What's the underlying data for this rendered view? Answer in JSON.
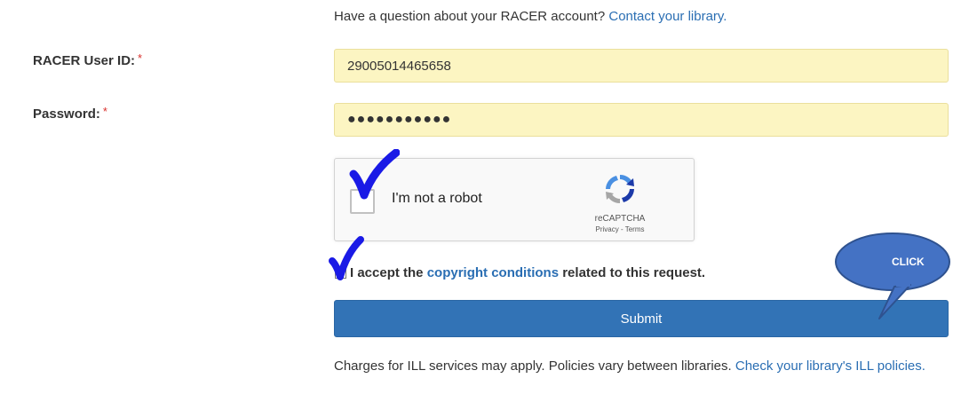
{
  "intro": {
    "text": "Have a question about your RACER account?",
    "link": "Contact your library."
  },
  "form": {
    "userid_label": "RACER User ID:",
    "password_label": "Password:",
    "required_marker": "*",
    "userid_value": "29005014465658",
    "password_value": "●●●●●●●●●●●"
  },
  "captcha": {
    "label": "I'm not a robot",
    "brand": "reCAPTCHA",
    "privacy": "Privacy",
    "separator": " - ",
    "terms": "Terms"
  },
  "copyright": {
    "prefix": "I accept the",
    "link": "copyright conditions",
    "suffix": "related to this request."
  },
  "submit_label": "Submit",
  "footer": {
    "text": "Charges for ILL services may apply. Policies vary between libraries.",
    "link": "Check your library's ILL policies."
  },
  "annotation": {
    "callout_text": "CLICK",
    "callout_color": "#4472c4",
    "check_color": "#1a1ae6"
  },
  "colors": {
    "link": "#2a6eb3",
    "input_bg": "#fcf5c2",
    "submit_bg": "#3273b6",
    "required": "#d9302c"
  },
  "icons": [
    "recaptcha-logo-icon",
    "hand-drawn-check-icon"
  ]
}
